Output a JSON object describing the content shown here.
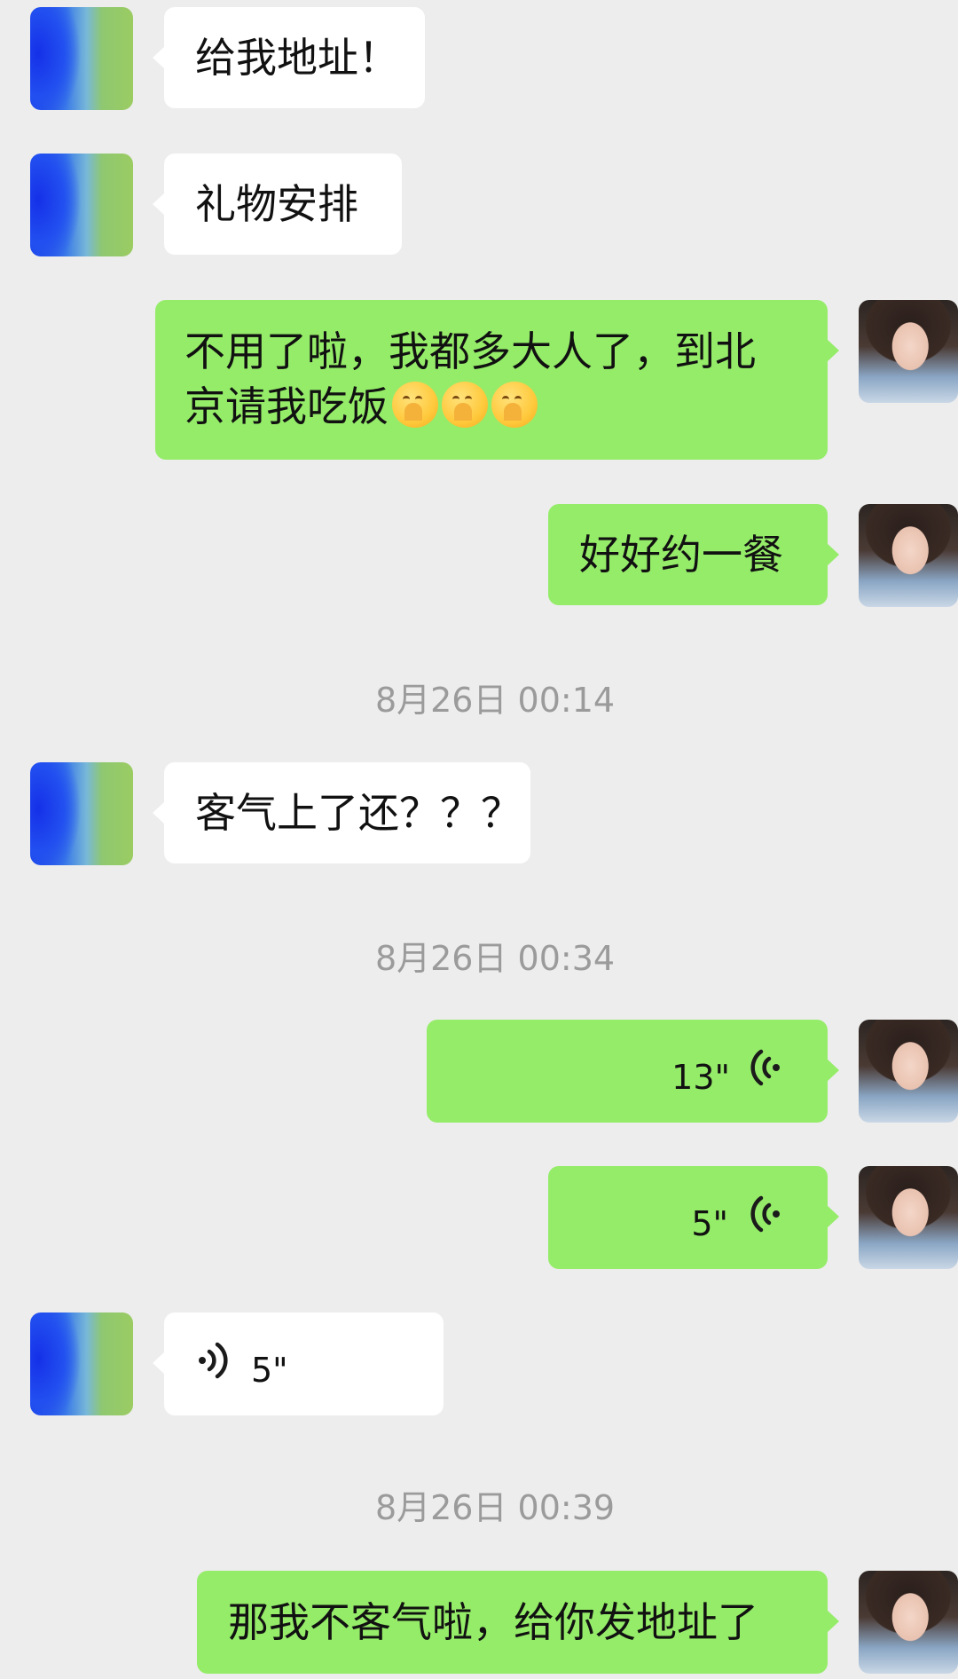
{
  "messages": [
    {
      "id": 1,
      "side": "in",
      "type": "text",
      "text": "给我地址！"
    },
    {
      "id": 2,
      "side": "in",
      "type": "text",
      "text": "礼物安排"
    },
    {
      "id": 3,
      "side": "out",
      "type": "text",
      "line1": "不用了啦，我都多大人了，到北",
      "line2": "京请我吃饭",
      "emojis": [
        "face-with-hand-over-mouth-emoji",
        "face-with-hand-over-mouth-emoji",
        "face-with-hand-over-mouth-emoji"
      ]
    },
    {
      "id": 4,
      "side": "out",
      "type": "text",
      "text": "好好约一餐"
    },
    {
      "id": 5,
      "side": "in",
      "type": "text",
      "text": "客气上了还？？？"
    },
    {
      "id": 6,
      "side": "out",
      "type": "voice",
      "duration": "13\""
    },
    {
      "id": 7,
      "side": "out",
      "type": "voice",
      "duration": "5\""
    },
    {
      "id": 8,
      "side": "in",
      "type": "voice",
      "duration": "5\""
    },
    {
      "id": 9,
      "side": "out",
      "type": "text",
      "text": "那我不客气啦，给你发地址了"
    }
  ],
  "timestamps": [
    "8月26日 00:14",
    "8月26日 00:34",
    "8月26日 00:39"
  ],
  "colors": {
    "background": "#ededed",
    "outgoing_bubble": "#95ec69",
    "incoming_bubble": "#ffffff",
    "timestamp_text": "#9b9b9b"
  }
}
